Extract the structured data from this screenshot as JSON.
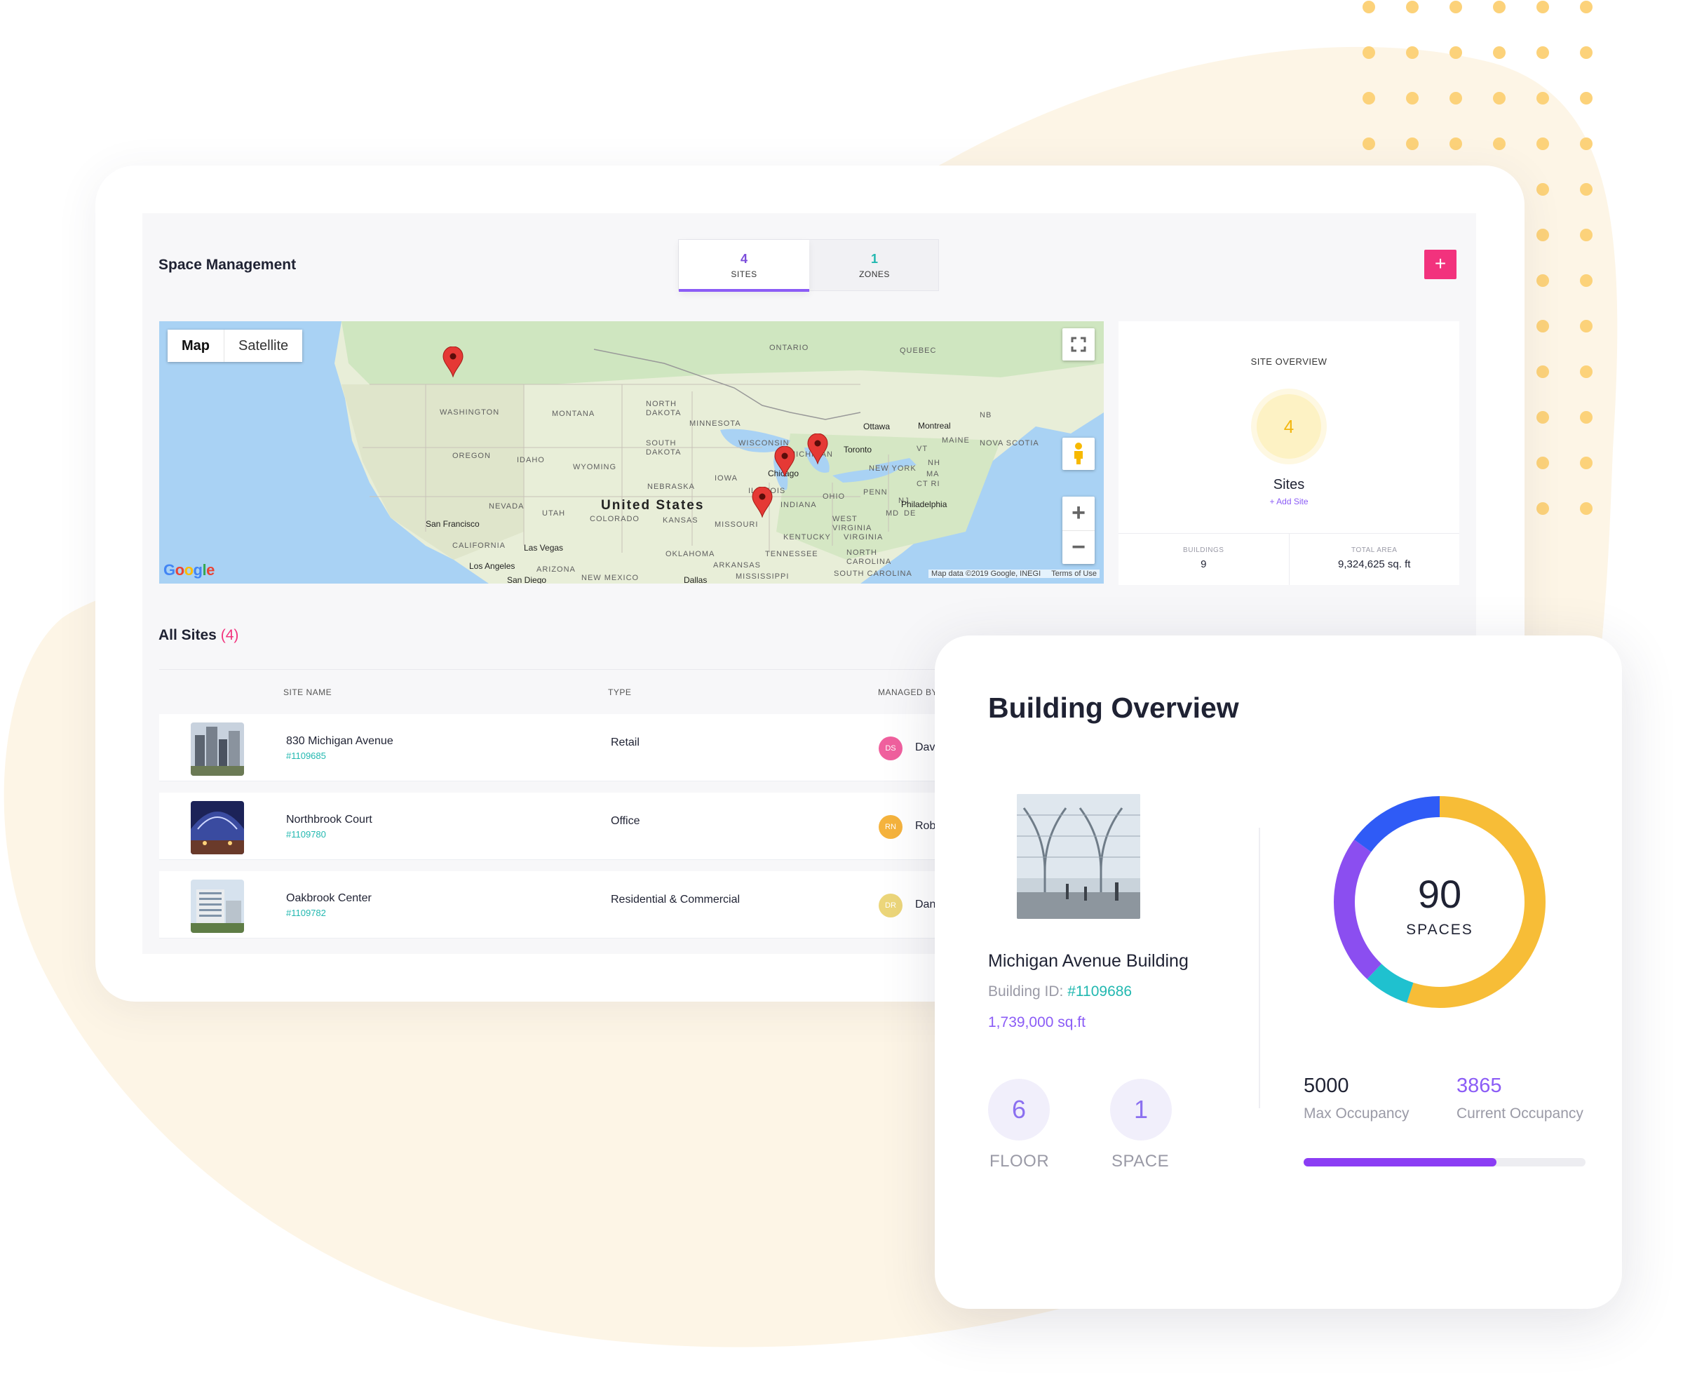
{
  "header": {
    "title": "Space Management",
    "add_icon": "plus-icon",
    "add_symbol": "+"
  },
  "tabs": [
    {
      "count": "4",
      "label": "SITES",
      "active": true
    },
    {
      "count": "1",
      "label": "ZONES",
      "active": false
    }
  ],
  "map": {
    "toggle": [
      "Map",
      "Satellite"
    ],
    "logo": "Google",
    "attribution": "Map data ©2019 Google, INEGI",
    "terms": "Terms of Use",
    "zoom_in": "+",
    "zoom_out": "−",
    "country_label": "United States",
    "region_labels": [
      "ONTARIO",
      "QUEBEC",
      "WASHINGTON",
      "MONTANA",
      "NORTH DAKOTA",
      "MINNESOTA",
      "OREGON",
      "IDAHO",
      "WYOMING",
      "SOUTH DAKOTA",
      "WISCONSIN",
      "MICHIGAN",
      "IOWA",
      "NEBRASKA",
      "NEVADA",
      "UTAH",
      "COLORADO",
      "KANSAS",
      "MISSOURI",
      "ILLINOIS",
      "INDIANA",
      "OHIO",
      "PENN",
      "NEW YORK",
      "NB",
      "MAINE",
      "NOVA SCOTIA",
      "VT",
      "NH",
      "MA",
      "CT RI",
      "NJ",
      "DE",
      "MD",
      "WEST VIRGINIA",
      "VIRGINIA",
      "KENTUCKY",
      "TENNESSEE",
      "NORTH CAROLINA",
      "SOUTH CAROLINA",
      "OKLAHOMA",
      "ARKANSAS",
      "MISSISSIPPI",
      "NEW MEXICO",
      "ARIZONA",
      "CALIFORNIA"
    ],
    "city_labels": [
      "Ottawa",
      "Montreal",
      "Toronto",
      "Chicago",
      "Philadelphia",
      "San Francisco",
      "Las Vegas",
      "Los Angeles",
      "San Diego",
      "Dallas"
    ],
    "marker_count": 4
  },
  "overview": {
    "title": "SITE OVERVIEW",
    "count": "4",
    "label": "Sites",
    "add_link": "+ Add Site",
    "stats": [
      {
        "label": "BUILDINGS",
        "value": "9"
      },
      {
        "label": "TOTAL AREA",
        "value": "9,324,625 sq. ft"
      }
    ]
  },
  "sites": {
    "title": "All Sites",
    "count": "(4)",
    "columns": [
      "SITE NAME",
      "TYPE",
      "MANAGED BY"
    ],
    "rows": [
      {
        "name": "830 Michigan Avenue",
        "id": "#1109685",
        "type": "Retail",
        "initials": "DS",
        "manager": "Dav",
        "avatar_color": "#f0609e"
      },
      {
        "name": "Northbrook Court",
        "id": "#1109780",
        "type": "Office",
        "initials": "RN",
        "manager": "Rob",
        "avatar_color": "#f5b33d"
      },
      {
        "name": "Oakbrook Center",
        "id": "#1109782",
        "type": "Residential & Commercial",
        "initials": "DR",
        "manager": "Dan",
        "avatar_color": "#ecd67a"
      }
    ]
  },
  "building": {
    "title": "Building Overview",
    "name": "Michigan Avenue Building",
    "id_label": "Building ID:",
    "id_value": "#1109686",
    "area": "1,739,000 sq.ft",
    "floor_count": "6",
    "floor_label": "FLOOR",
    "space_count": "1",
    "space_label": "SPACE",
    "donut_total": "90",
    "donut_label": "SPACES",
    "donut_segments": [
      {
        "color": "#f7bd37",
        "fraction": 0.55
      },
      {
        "color": "#1fc1cf",
        "fraction": 0.07
      },
      {
        "color": "#8b4ef0",
        "fraction": 0.23
      },
      {
        "color": "#2f5bf6",
        "fraction": 0.15
      }
    ],
    "max_occupancy": "5000",
    "max_label": "Max Occupancy",
    "current_occupancy": "3865",
    "current_label": "Current Occupancy",
    "occupancy_fraction": 0.683
  },
  "colors": {
    "accent": "#8b5cf6",
    "pink": "#f2327d",
    "teal": "#22b8b0",
    "yellow": "#f7bd37"
  }
}
